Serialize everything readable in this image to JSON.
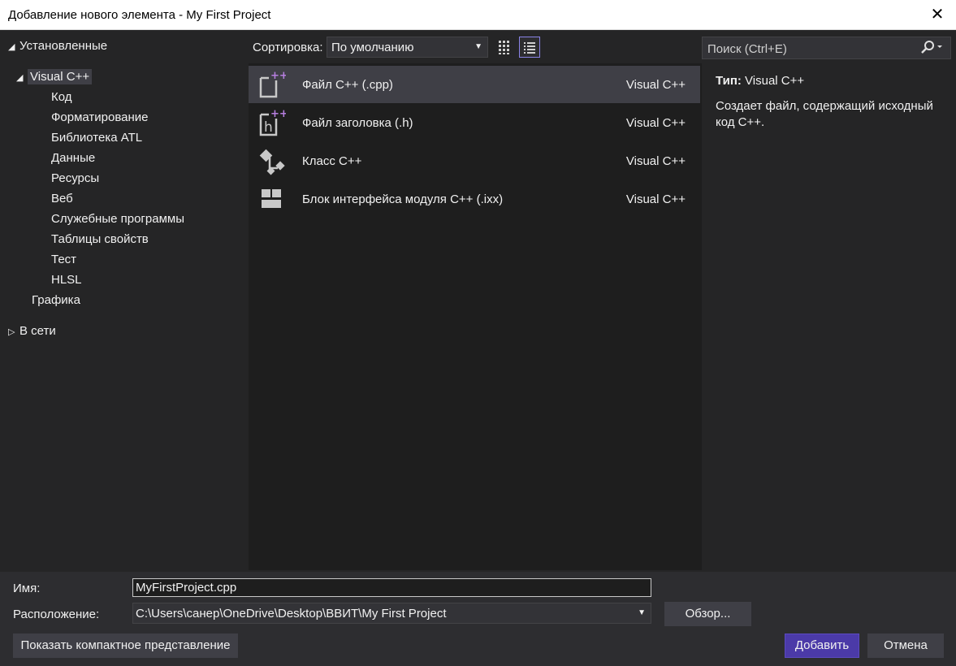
{
  "window": {
    "title": "Добавление нового элемента  - My First Project",
    "close_glyph": "✕"
  },
  "tree": {
    "installed": "Установленные",
    "visual_cpp": "Visual C++",
    "children": [
      "Код",
      "Форматирование",
      "Библиотека ATL",
      "Данные",
      "Ресурсы",
      "Веб",
      "Служебные программы",
      "Таблицы свойств",
      "Тест",
      "HLSL"
    ],
    "graphics": "Графика",
    "online": "В сети"
  },
  "toolbar": {
    "sort_label": "Сортировка:",
    "sort_value": "По умолчанию",
    "search_placeholder": "Поиск (Ctrl+E)"
  },
  "templates": [
    {
      "name": "Файл C++ (.cpp)",
      "lang": "Visual C++",
      "icon": "cpp-file-icon",
      "selected": true
    },
    {
      "name": "Файл заголовка (.h)",
      "lang": "Visual C++",
      "icon": "header-file-icon",
      "selected": false
    },
    {
      "name": "Класс C++",
      "lang": "Visual C++",
      "icon": "class-icon",
      "selected": false
    },
    {
      "name": "Блок интерфейса модуля C++ (.ixx)",
      "lang": "Visual C++",
      "icon": "module-interface-icon",
      "selected": false
    }
  ],
  "info": {
    "type_label": "Тип:",
    "type_value": "Visual C++",
    "description": "Создает файл, содержащий исходный код C++."
  },
  "bottom": {
    "name_label": "Имя:",
    "name_value": "MyFirstProject.cpp",
    "location_label": "Расположение:",
    "location_value": "C:\\Users\\санер\\OneDrive\\Desktop\\ВВИТ\\My First Project",
    "browse": "Обзор...",
    "compact": "Показать компактное представление",
    "add": "Добавить",
    "cancel": "Отмена"
  },
  "colors": {
    "accent": "#8a83e6",
    "primary_button": "#4b3aa8",
    "icon_gray": "#c8c8c8",
    "icon_plus": "#b77fe0"
  }
}
